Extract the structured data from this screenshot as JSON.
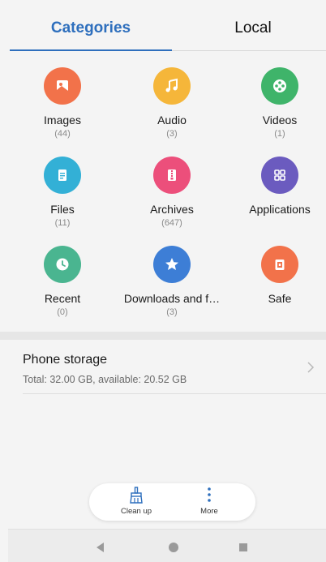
{
  "tabs": [
    {
      "label": "Categories",
      "active": true
    },
    {
      "label": "Local",
      "active": false
    }
  ],
  "accent_color": "#2e6fbd",
  "categories": [
    {
      "label": "Images",
      "count": "(44)",
      "color": "#f2724a",
      "icon": "image-icon"
    },
    {
      "label": "Audio",
      "count": "(3)",
      "color": "#f5b63a",
      "icon": "music-note-icon"
    },
    {
      "label": "Videos",
      "count": "(1)",
      "color": "#3fb46a",
      "icon": "film-reel-icon"
    },
    {
      "label": "Files",
      "count": "(11)",
      "color": "#33b0d6",
      "icon": "document-icon"
    },
    {
      "label": "Archives",
      "count": "(647)",
      "color": "#ec4f7b",
      "icon": "archive-zip-icon"
    },
    {
      "label": "Applications",
      "count": "",
      "color": "#6b5bbf",
      "icon": "apps-grid-icon"
    },
    {
      "label": "Recent",
      "count": "(0)",
      "color": "#4ab590",
      "icon": "clock-icon"
    },
    {
      "label": "Downloads and f…",
      "count": "(3)",
      "color": "#3d7ed6",
      "icon": "star-icon"
    },
    {
      "label": "Safe",
      "count": "",
      "color": "#f2724a",
      "icon": "safe-lock-icon"
    }
  ],
  "storage": {
    "title": "Phone storage",
    "info": "Total: 32.00 GB, available: 20.52 GB"
  },
  "actions": {
    "cleanup_label": "Clean up",
    "more_label": "More"
  },
  "nav": {
    "back": "back-icon",
    "home": "home-icon",
    "recent": "recent-apps-icon"
  }
}
